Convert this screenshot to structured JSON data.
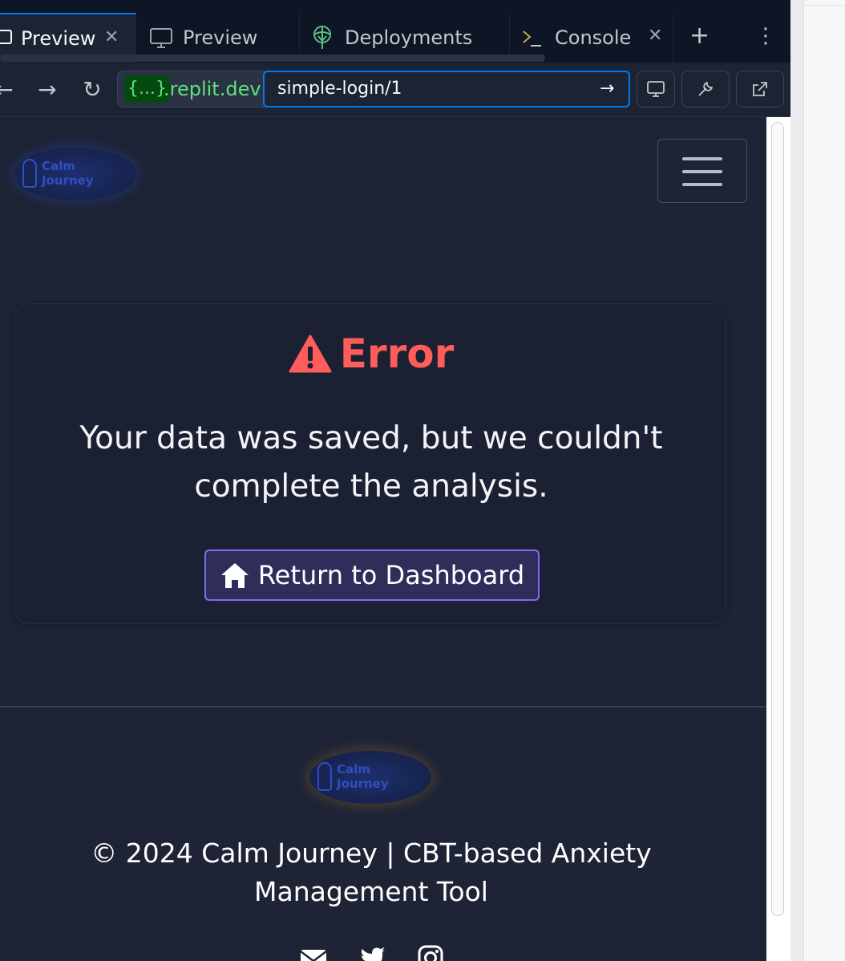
{
  "tabs": [
    {
      "label": "Preview",
      "active": true,
      "closable": true
    },
    {
      "label": "Preview",
      "active": false,
      "closable": false
    },
    {
      "label": "Deployments",
      "active": false,
      "closable": false
    },
    {
      "label": "Console",
      "active": false,
      "closable": true
    }
  ],
  "urlbar": {
    "domain_chip": "{...}",
    "domain": ".replit.dev",
    "path": "simple-login/1"
  },
  "page": {
    "logo_text_line1": "Calm",
    "logo_text_line2": "Journey",
    "error_title": "Error",
    "error_message": "Your data was saved, but we couldn't complete the analysis.",
    "return_button": "Return to Dashboard",
    "footer_text": "© 2024 Calm Journey | CBT-based Anxiety Management Tool"
  },
  "colors": {
    "error": "#ff5c5c",
    "accent_button_border": "#7e6df2",
    "url_focus": "#0079f2",
    "domain_green": "#5ce17a"
  },
  "icons": [
    "monitor-icon",
    "deployments-icon",
    "console-icon",
    "plus-icon",
    "more-icon",
    "back-icon",
    "forward-icon",
    "reload-icon",
    "go-arrow-icon",
    "devices-icon",
    "wrench-icon",
    "external-link-icon",
    "warning-icon",
    "home-icon",
    "envelope-icon",
    "twitter-icon",
    "instagram-icon"
  ]
}
